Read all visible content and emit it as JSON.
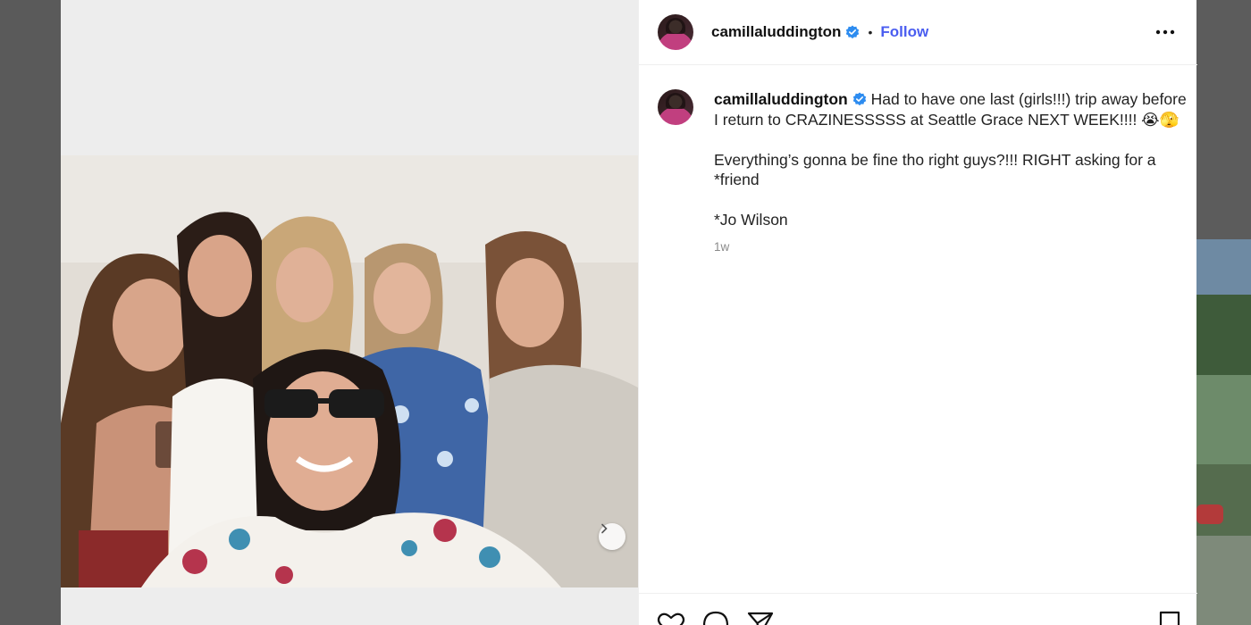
{
  "post": {
    "username": "camillaluddington",
    "follow_label": "Follow",
    "separator": "•",
    "caption": {
      "line1": "Had to have one last (girls!!!) trip away before I return to CRAZINESSSSS at Seattle Grace NEXT WEEK!!!! 😭🫣",
      "line2": "Everything’s gonna be fine tho right guys?!!! RIGHT asking for a *friend",
      "line3": "*Jo Wilson"
    },
    "time_ago": "1w"
  },
  "icons": {
    "verified": "verified-badge-icon",
    "more": "more-options-icon",
    "next": "chevron-right-icon",
    "like": "heart-icon",
    "comment": "comment-icon",
    "share": "paper-plane-icon",
    "save": "bookmark-icon"
  },
  "colors": {
    "follow": "#4a5df0",
    "verified": "#2d8cf0",
    "muted": "#8a8a8a"
  }
}
